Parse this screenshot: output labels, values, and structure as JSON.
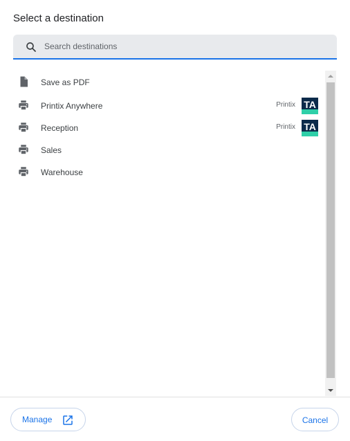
{
  "dialog": {
    "title": "Select a destination"
  },
  "search": {
    "placeholder": "Search destinations",
    "value": "",
    "icon": "search-icon"
  },
  "destinations": [
    {
      "label": "Save as PDF",
      "icon": "file-icon",
      "provider": ""
    },
    {
      "label": "Printix Anywhere",
      "icon": "printer-icon",
      "provider": "Printix",
      "provider_logo_text": "TA"
    },
    {
      "label": "Reception",
      "icon": "printer-icon",
      "provider": "Printix",
      "provider_logo_text": "TA"
    },
    {
      "label": "Sales",
      "icon": "printer-icon",
      "provider": ""
    },
    {
      "label": "Warehouse",
      "icon": "printer-icon",
      "provider": ""
    }
  ],
  "footer": {
    "manage_label": "Manage",
    "manage_icon": "open-in-new-icon",
    "cancel_label": "Cancel"
  },
  "colors": {
    "accent": "#1a73e8",
    "logo_dark": "#0b2a4a",
    "logo_accent": "#2ecfa8"
  }
}
